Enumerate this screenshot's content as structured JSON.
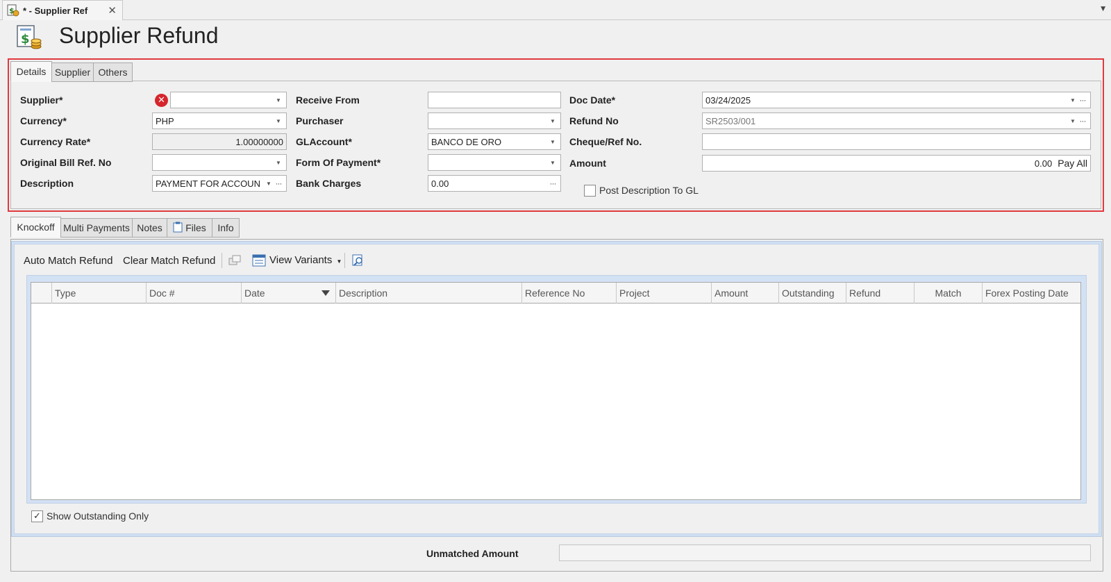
{
  "doc_tab": {
    "label": "* - Supplier Ref"
  },
  "page_title": "Supplier Refund",
  "header_tabs": [
    "Details",
    "Supplier",
    "Others"
  ],
  "form": {
    "supplier_label": "Supplier*",
    "supplier_value": "",
    "currency_label": "Currency*",
    "currency_value": "PHP",
    "currency_rate_label": "Currency Rate*",
    "currency_rate_value": "1.00000000",
    "original_bill_label": "Original Bill Ref. No",
    "original_bill_value": "",
    "description_label": "Description",
    "description_value": "PAYMENT FOR ACCOUN",
    "receive_from_label": "Receive From",
    "receive_from_value": "",
    "purchaser_label": "Purchaser",
    "purchaser_value": "",
    "glaccount_label": "GLAccount*",
    "glaccount_value": "BANCO DE ORO",
    "form_of_payment_label": "Form Of Payment*",
    "form_of_payment_value": "",
    "bank_charges_label": "Bank Charges",
    "bank_charges_value": "0.00",
    "doc_date_label": "Doc Date*",
    "doc_date_value": "03/24/2025",
    "refund_no_label": "Refund No",
    "refund_no_value": "SR2503/001",
    "cheque_label": "Cheque/Ref No.",
    "cheque_value": "",
    "amount_label": "Amount",
    "amount_value": "0.00",
    "pay_all_label": "Pay All",
    "post_desc_label": "Post Description To GL",
    "post_desc_checked": false
  },
  "lower_tabs": [
    "Knockoff",
    "Multi Payments",
    "Notes",
    "Files",
    "Info"
  ],
  "toolbar": {
    "auto_match": "Auto Match Refund",
    "clear_match": "Clear Match Refund",
    "view_variants": "View Variants"
  },
  "grid_columns": [
    "Type",
    "Doc #",
    "Date",
    "Description",
    "Reference No",
    "Project",
    "Amount",
    "Outstanding",
    "Refund",
    "Match",
    "Forex Posting Date"
  ],
  "show_outstanding_label": "Show Outstanding Only",
  "show_outstanding_checked": true,
  "unmatched_amount_label": "Unmatched Amount",
  "unmatched_amount_value": "",
  "colors": {
    "frame_highlight": "#e0393e",
    "error_icon": "#d6252c",
    "grid_panel": "#cfdff3"
  }
}
